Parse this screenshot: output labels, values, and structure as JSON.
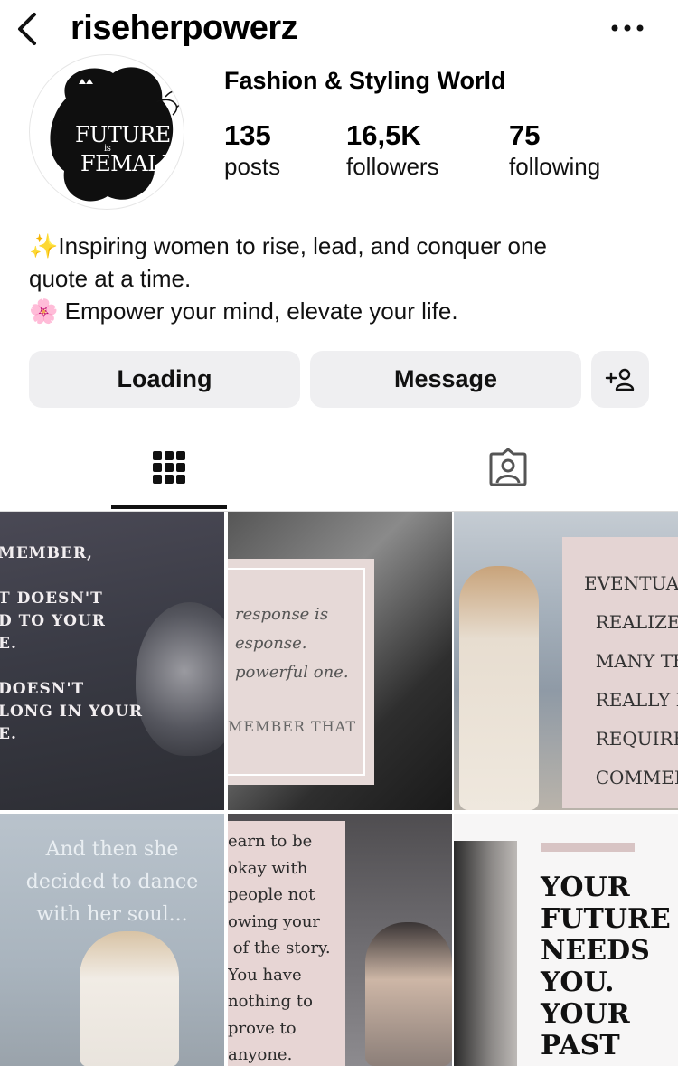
{
  "header": {
    "username": "riseherpowerz",
    "back_icon": "chevron-left-icon",
    "more_icon": "more-horizontal-icon"
  },
  "profile": {
    "avatar_text_top": "FUTURE",
    "avatar_text_mid": "is",
    "avatar_text_bottom": "FEMALE",
    "display_name": "Fashion & Styling World",
    "stats": [
      {
        "value": "135",
        "label": "posts"
      },
      {
        "value": "16,5K",
        "label": "followers"
      },
      {
        "value": "75",
        "label": "following"
      }
    ],
    "bio": [
      "✨Inspiring women to rise, lead, and conquer one",
      "quote at a time.",
      "🌸 Empower your mind, elevate your life."
    ]
  },
  "actions": {
    "primary_label": "Loading",
    "message_label": "Message",
    "add_user_icon": "add-user-icon"
  },
  "tabs": [
    {
      "name": "posts-grid",
      "icon": "grid-icon",
      "selected": true
    },
    {
      "name": "tagged",
      "icon": "tagged-person-icon",
      "selected": false
    }
  ],
  "posts": [
    {
      "text": "MEMBER,\n\nT DOESN'T\nD TO YOUR\nE.\n\nDOESN'T\nLONG IN YOUR\nE."
    },
    {
      "text": "response is\nesponse.\npowerful one.",
      "footer": "MEMBER THAT"
    },
    {
      "text": "EVENTUALLY\n  REALIZE HO\n  MANY THIN\n  REALLY DO\n  REQUIRE YO\n  COMMENT"
    },
    {
      "text": "And then she\ndecided to dance\nwith her soul..."
    },
    {
      "text": "earn to be\nokay with\npeople not\nowing your\n of the story.\nYou have\nnothing to\nprove to\nanyone."
    },
    {
      "text": "YOUR\nFUTURE\nNEEDS\nYOU.\nYOUR\nPAST"
    }
  ],
  "colors": {
    "button_bg": "#efeff1",
    "text": "#000000",
    "tab_underline": "#111111"
  }
}
